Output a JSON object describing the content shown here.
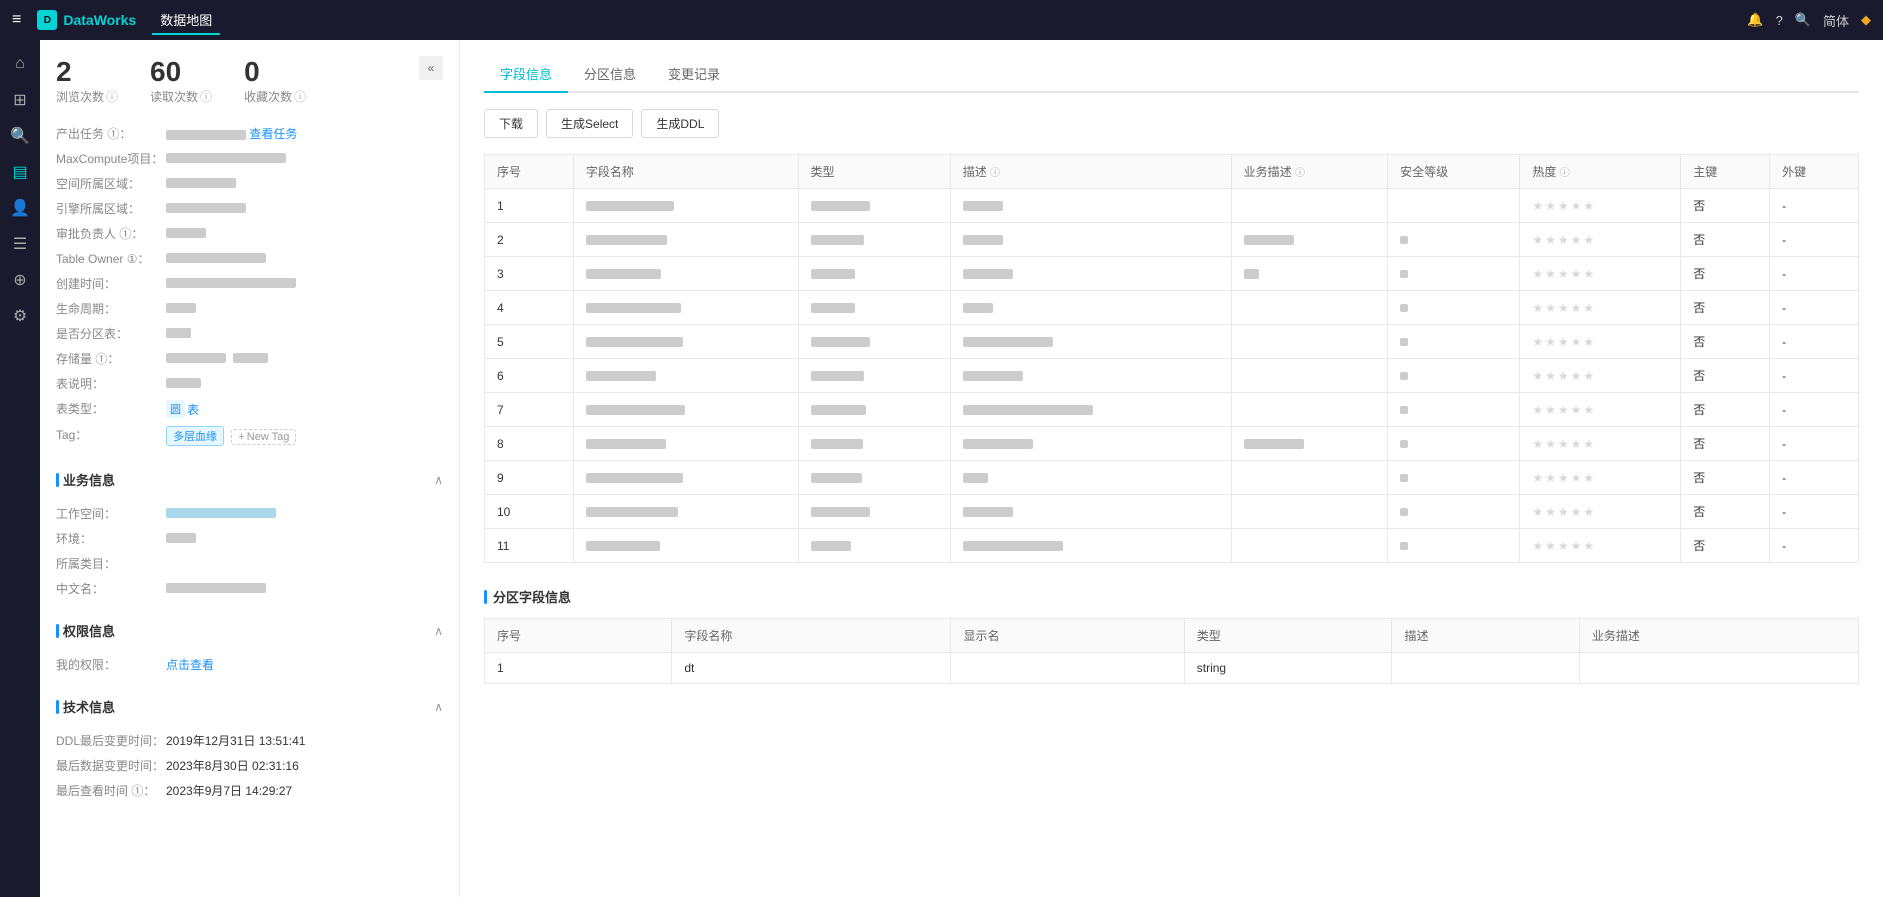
{
  "topNav": {
    "menuIcon": "≡",
    "logo": "DataWorks",
    "navItems": [
      "数据地图"
    ],
    "language": "简体"
  },
  "stats": {
    "views": {
      "num": "2",
      "label": "浏览次数"
    },
    "downloads": {
      "num": "60",
      "label": "读取次数"
    },
    "favorites": {
      "num": "0",
      "label": "收藏次数"
    }
  },
  "infoSection": {
    "rows": [
      {
        "label": "产出任务 ①：",
        "hasLink": true,
        "linkText": "查看任务"
      },
      {
        "label": "MaxCompute项目：",
        "value": ""
      },
      {
        "label": "空间所属区域：",
        "value": ""
      },
      {
        "label": "引擎所属区域：",
        "value": ""
      },
      {
        "label": "审批负责人 ①：",
        "value": ""
      },
      {
        "label": "Table Owner ①：",
        "value": ""
      },
      {
        "label": "创建时间：",
        "value": ""
      },
      {
        "label": "生命周期：",
        "value": ""
      },
      {
        "label": "是否分区表：",
        "value": ""
      },
      {
        "label": "存储量 ①：",
        "value": ""
      },
      {
        "label": "表说明：",
        "value": ""
      },
      {
        "label": "表类型：",
        "tableType": true,
        "value": "表"
      },
      {
        "label": "Tag：",
        "tag": "多层血缘",
        "newTag": "New Tag"
      }
    ]
  },
  "businessSection": {
    "title": "业务信息",
    "rows": [
      {
        "label": "工作空间：",
        "value": ""
      },
      {
        "label": "环境：",
        "value": ""
      },
      {
        "label": "所属类目：",
        "value": ""
      },
      {
        "label": "中文名：",
        "value": ""
      }
    ]
  },
  "permissionSection": {
    "title": "权限信息",
    "myPermLink": "点击查看"
  },
  "techSection": {
    "title": "技术信息",
    "rows": [
      {
        "label": "DDL最后变更时间：",
        "value": "2019年12月31日 13:51:41"
      },
      {
        "label": "最后数据变更时间：",
        "value": "2023年8月30日 02:31:16"
      },
      {
        "label": "最后查看时间 ①：",
        "value": "2023年9月7日 14:29:27"
      }
    ]
  },
  "tabs": [
    {
      "id": "fields",
      "label": "字段信息",
      "active": true
    },
    {
      "id": "partitions",
      "label": "分区信息",
      "active": false
    },
    {
      "id": "changes",
      "label": "变更记录",
      "active": false
    }
  ],
  "actionButtons": [
    {
      "id": "download",
      "label": "下载"
    },
    {
      "id": "generate-select",
      "label": "生成Select"
    },
    {
      "id": "generate-ddl",
      "label": "生成DDL"
    }
  ],
  "fieldTable": {
    "columns": [
      "序号",
      "字段名称",
      "类型",
      "描述",
      "业务描述",
      "安全等级",
      "热度",
      "主键",
      "外键"
    ],
    "rows": [
      {
        "id": "1",
        "primary": "否"
      },
      {
        "id": "2",
        "primary": "否"
      },
      {
        "id": "3",
        "primary": "否"
      },
      {
        "id": "4",
        "primary": "否"
      },
      {
        "id": "5",
        "primary": "否"
      },
      {
        "id": "6",
        "primary": "否"
      },
      {
        "id": "7",
        "primary": "否"
      },
      {
        "id": "8",
        "primary": "否"
      },
      {
        "id": "9",
        "primary": "否"
      },
      {
        "id": "10",
        "primary": "否"
      },
      {
        "id": "11",
        "primary": "否"
      }
    ]
  },
  "partitionSection": {
    "title": "分区字段信息",
    "columns": [
      "序号",
      "字段名称",
      "显示名",
      "类型",
      "描述",
      "业务描述"
    ],
    "rows": [
      {
        "id": "1",
        "fieldName": "dt",
        "displayName": "",
        "type": "string",
        "desc": "",
        "bizDesc": ""
      }
    ]
  }
}
